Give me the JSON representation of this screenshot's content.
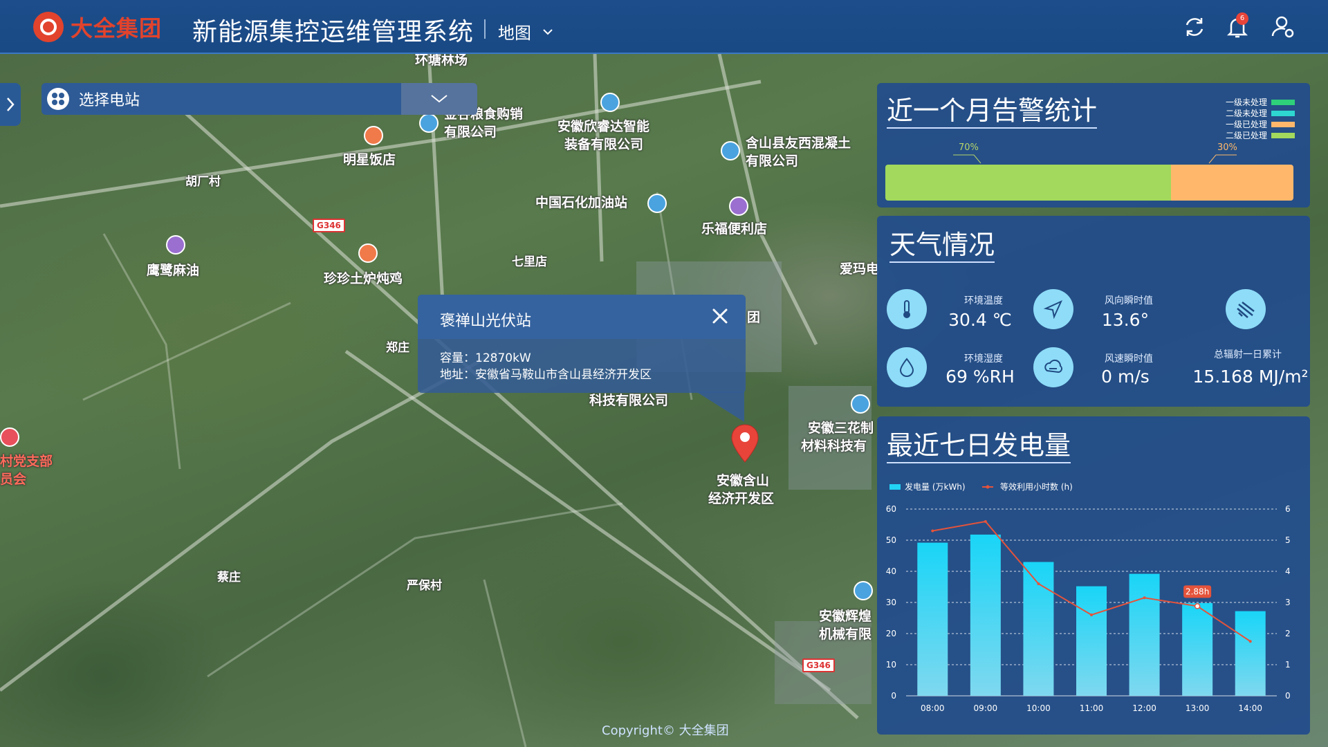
{
  "header": {
    "brand": "大全集团",
    "system_title": "新能源集控运维管理系统",
    "view": "地图",
    "notification_count": "6"
  },
  "station_select": {
    "label": "选择电站"
  },
  "map": {
    "labels": [
      {
        "text": "环塘林场"
      },
      {
        "text": "金谷粮食购销"
      },
      {
        "text": "有限公司"
      },
      {
        "text": "明星饭店"
      },
      {
        "text": "胡厂村"
      },
      {
        "text": "安徽欣睿达智能"
      },
      {
        "text": "装备有限公司"
      },
      {
        "text": "含山县友西混凝土"
      },
      {
        "text": "有限公司"
      },
      {
        "text": "中国石化加油站"
      },
      {
        "text": "乐福便利店"
      },
      {
        "text": "鹰鹭麻油"
      },
      {
        "text": "珍珍土炉炖鸡"
      },
      {
        "text": "七里店"
      },
      {
        "text": "爱玛电"
      },
      {
        "text": "团"
      },
      {
        "text": "郑庄"
      },
      {
        "text": "科技有限公司"
      },
      {
        "text": "安徽三花制"
      },
      {
        "text": "材料科技有"
      },
      {
        "text": "安徽含山"
      },
      {
        "text": "经济开发区"
      },
      {
        "text": "村党支部"
      },
      {
        "text": "员会"
      },
      {
        "text": "蔡庄"
      },
      {
        "text": "严保村"
      },
      {
        "text": "安徽辉煌"
      },
      {
        "text": "机械有限"
      }
    ],
    "road_shields": [
      "G346",
      "G346"
    ],
    "copyright": "Copyright© 大全集团"
  },
  "popup": {
    "title": "褒禅山光伏站",
    "capacity_label": "容量：",
    "capacity_value": "12870kW",
    "address_label": "地址：",
    "address_value": "安徽省马鞍山市含山县经济开发区"
  },
  "alarm_panel": {
    "title": "近一个月告警统计",
    "legend": [
      {
        "name": "一级未处理",
        "color": "#2fd07a"
      },
      {
        "name": "二级未处理",
        "color": "#2ed8d0"
      },
      {
        "name": "一级已处理",
        "color": "#ffb86b"
      },
      {
        "name": "二级已处理",
        "color": "#a3d95c"
      }
    ],
    "segments": [
      {
        "label": "70%",
        "value": 70,
        "color": "#a3d95c"
      },
      {
        "label": "30%",
        "value": 30,
        "color": "#ffb86b"
      }
    ]
  },
  "weather_panel": {
    "title": "天气情况",
    "items": [
      {
        "label": "环境温度",
        "value": "30.4 ℃",
        "icon": "thermometer-icon"
      },
      {
        "label": "风向瞬时值",
        "value": "13.6°",
        "icon": "wind-direction-icon"
      },
      {
        "label": "",
        "value": "",
        "icon": "radiation-icon"
      },
      {
        "label": "环境湿度",
        "value": "69 %RH",
        "icon": "humidity-icon"
      },
      {
        "label": "风速瞬时值",
        "value": "0 m/s",
        "icon": "wind-speed-icon"
      },
      {
        "label": "总辐射一日累计",
        "value": "15.168 MJ/m²",
        "icon": ""
      }
    ]
  },
  "generation_panel": {
    "title": "最近七日发电量"
  },
  "chart_data": {
    "type": "bar",
    "categories": [
      "08:00",
      "09:00",
      "10:00",
      "11:00",
      "12:00",
      "13:00",
      "14:00"
    ],
    "series": [
      {
        "name": "发电量 (万kWh)",
        "type": "bar",
        "axis": "left",
        "color": "#22d3f5",
        "values": [
          49.2,
          51.8,
          43,
          35.2,
          39.2,
          29.8,
          27.2
        ]
      },
      {
        "name": "等效利用小时数 (h)",
        "type": "line",
        "axis": "right",
        "color": "#e5533b",
        "values": [
          5.3,
          5.6,
          3.6,
          2.6,
          3.15,
          2.88,
          1.75
        ]
      }
    ],
    "ylim_left": [
      0,
      60
    ],
    "ylim_right": [
      0,
      6
    ],
    "yticks_left": [
      0,
      10,
      20,
      30,
      40,
      50,
      60
    ],
    "yticks_right": [
      0,
      1,
      2,
      3,
      4,
      5,
      6
    ],
    "annotation": {
      "category": "13:00",
      "text": "2.88h"
    },
    "grid": true,
    "legend_position": "top-left"
  }
}
